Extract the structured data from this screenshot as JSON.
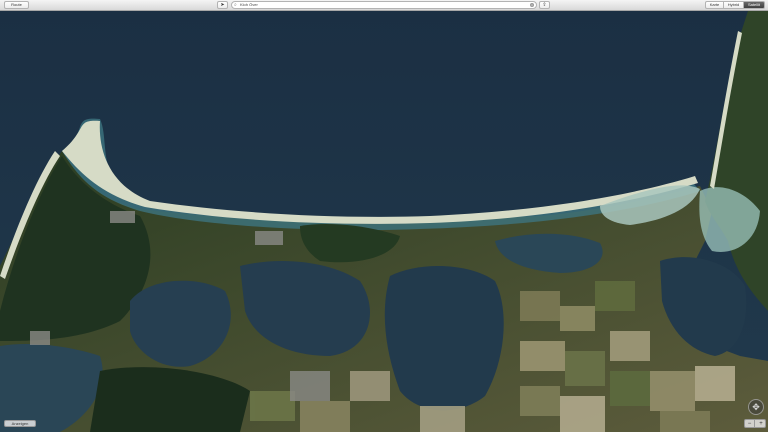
{
  "toolbar": {
    "route_label": "Route",
    "locate_icon": "location-arrow-icon",
    "search_value": "Kloh Över",
    "share_icon": "share-icon",
    "views": [
      "Karte",
      "Hybrid",
      "Satellit"
    ],
    "selected_view": "Satellit"
  },
  "map": {
    "legend_label": "Anzeigen",
    "compass_icon": "compass-icon",
    "zoom_out_label": "−",
    "zoom_in_label": "+"
  },
  "colors": {
    "sea": "#1d3246",
    "shallow": "#4f8a8e",
    "beach": "#d8dcc8",
    "forest": "#23351f",
    "fields": "#6b6a45"
  }
}
